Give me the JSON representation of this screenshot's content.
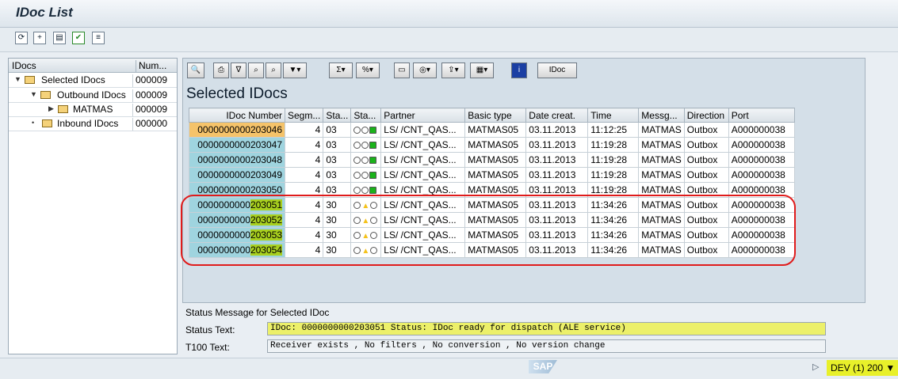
{
  "window": {
    "title": "IDoc List"
  },
  "toolbar": {
    "icons": [
      "refresh-icon",
      "new-selection-icon",
      "display-icon",
      "check-icon",
      "list-icon"
    ]
  },
  "tree": {
    "col_idocs": "IDocs",
    "col_num": "Num...",
    "rows": [
      {
        "label": "Selected IDocs",
        "num": "000009"
      },
      {
        "label": "Outbound IDocs",
        "num": "000009"
      },
      {
        "label": "MATMAS",
        "num": "000009"
      },
      {
        "label": "Inbound IDocs",
        "num": "000000"
      }
    ]
  },
  "grid_toolbar": {
    "idoc_button": "IDoc"
  },
  "grid": {
    "title": "Selected IDocs",
    "headers": [
      "IDoc Number",
      "Segm...",
      "Sta...",
      "Sta...",
      "Partner",
      "Basic type",
      "Date creat.",
      "Time",
      "Messg...",
      "Direction",
      "Port"
    ],
    "rows": [
      {
        "id_pre": "0000000000203046",
        "id_hl": "",
        "segm": "4",
        "status": "03",
        "lights": "green",
        "partner": "LS/ /CNT_QAS...",
        "basic": "MATMAS05",
        "date": "03.11.2013",
        "time": "11:12:25",
        "msg": "MATMAS",
        "dir": "Outbox",
        "port": "A000000038"
      },
      {
        "id_pre": "0000000000203047",
        "id_hl": "",
        "segm": "4",
        "status": "03",
        "lights": "green",
        "partner": "LS/ /CNT_QAS...",
        "basic": "MATMAS05",
        "date": "03.11.2013",
        "time": "11:19:28",
        "msg": "MATMAS",
        "dir": "Outbox",
        "port": "A000000038"
      },
      {
        "id_pre": "0000000000203048",
        "id_hl": "",
        "segm": "4",
        "status": "03",
        "lights": "green",
        "partner": "LS/ /CNT_QAS...",
        "basic": "MATMAS05",
        "date": "03.11.2013",
        "time": "11:19:28",
        "msg": "MATMAS",
        "dir": "Outbox",
        "port": "A000000038"
      },
      {
        "id_pre": "0000000000203049",
        "id_hl": "",
        "segm": "4",
        "status": "03",
        "lights": "green",
        "partner": "LS/ /CNT_QAS...",
        "basic": "MATMAS05",
        "date": "03.11.2013",
        "time": "11:19:28",
        "msg": "MATMAS",
        "dir": "Outbox",
        "port": "A000000038"
      },
      {
        "id_pre": "0000000000203050",
        "id_hl": "",
        "segm": "4",
        "status": "03",
        "lights": "green",
        "partner": "LS/ /CNT_QAS...",
        "basic": "MATMAS05",
        "date": "03.11.2013",
        "time": "11:19:28",
        "msg": "MATMAS",
        "dir": "Outbox",
        "port": "A000000038"
      },
      {
        "id_pre": "0000000000",
        "id_hl": "203051",
        "segm": "4",
        "status": "30",
        "lights": "yellow",
        "partner": "LS/ /CNT_QAS...",
        "basic": "MATMAS05",
        "date": "03.11.2013",
        "time": "11:34:26",
        "msg": "MATMAS",
        "dir": "Outbox",
        "port": "A000000038"
      },
      {
        "id_pre": "0000000000",
        "id_hl": "203052",
        "segm": "4",
        "status": "30",
        "lights": "yellow",
        "partner": "LS/ /CNT_QAS...",
        "basic": "MATMAS05",
        "date": "03.11.2013",
        "time": "11:34:26",
        "msg": "MATMAS",
        "dir": "Outbox",
        "port": "A000000038"
      },
      {
        "id_pre": "0000000000",
        "id_hl": "203053",
        "segm": "4",
        "status": "30",
        "lights": "yellow",
        "partner": "LS/ /CNT_QAS...",
        "basic": "MATMAS05",
        "date": "03.11.2013",
        "time": "11:34:26",
        "msg": "MATMAS",
        "dir": "Outbox",
        "port": "A000000038"
      },
      {
        "id_pre": "0000000000",
        "id_hl": "203054",
        "segm": "4",
        "status": "30",
        "lights": "yellow",
        "partner": "LS/ /CNT_QAS...",
        "basic": "MATMAS05",
        "date": "03.11.2013",
        "time": "11:34:26",
        "msg": "MATMAS",
        "dir": "Outbox",
        "port": "A000000038"
      }
    ]
  },
  "status": {
    "heading": "Status Message for Selected IDoc",
    "status_label": "Status Text:",
    "status_value": "IDoc: 0000000000203051 Status: IDoc ready for dispatch (ALE service)",
    "t100_label": "T100 Text:",
    "t100_value": "Receiver exists , No filters , No conversion , No version change"
  },
  "statusbar": {
    "sap_logo": "SAP",
    "system": "DEV (1) 200"
  },
  "colors": {
    "selected_row": "#f5c36a",
    "id_cell": "#9fd4df",
    "highlight": "#a8cf1f",
    "annotation": "#e01b1b"
  }
}
